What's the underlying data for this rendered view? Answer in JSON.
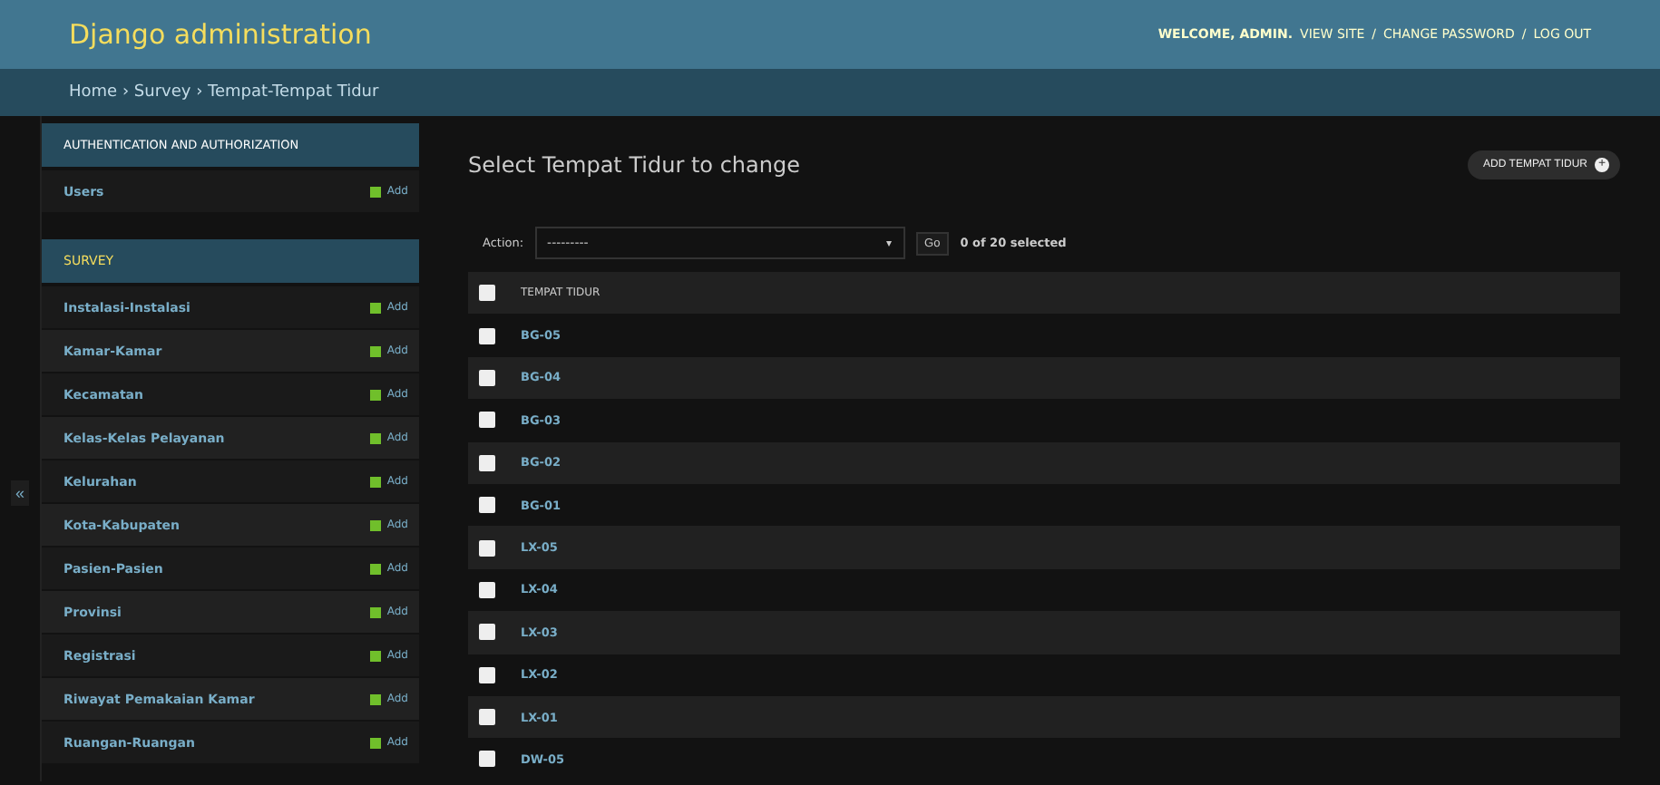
{
  "header": {
    "title": "Django administration",
    "user_tools": [
      {
        "kind": "text",
        "label": "WELCOME, ADMIN."
      },
      {
        "kind": "link",
        "label": "VIEW SITE"
      },
      {
        "kind": "sep",
        "label": "/"
      },
      {
        "kind": "link",
        "label": "CHANGE PASSWORD"
      },
      {
        "kind": "sep",
        "label": "/"
      },
      {
        "kind": "link",
        "label": "LOG OUT"
      }
    ]
  },
  "breadcrumbs": "Home › Survey › Tempat-Tempat Tidur",
  "sidebar": {
    "toggle": "«",
    "modules": [
      {
        "caption": "AUTHENTICATION AND AUTHORIZATION",
        "selected": false,
        "items": [
          {
            "label": "Users",
            "add": "Add"
          }
        ]
      },
      {
        "caption": "SURVEY",
        "selected": true,
        "items": [
          {
            "label": "Instalasi-Instalasi",
            "add": "Add"
          },
          {
            "label": "Kamar-Kamar",
            "add": "Add"
          },
          {
            "label": "Kecamatan",
            "add": "Add"
          },
          {
            "label": "Kelas-Kelas Pelayanan",
            "add": "Add"
          },
          {
            "label": "Kelurahan",
            "add": "Add"
          },
          {
            "label": "Kota-Kabupaten",
            "add": "Add"
          },
          {
            "label": "Pasien-Pasien",
            "add": "Add"
          },
          {
            "label": "Provinsi",
            "add": "Add"
          },
          {
            "label": "Registrasi",
            "add": "Add"
          },
          {
            "label": "Riwayat Pemakaian Kamar",
            "add": "Add"
          },
          {
            "label": "Ruangan-Ruangan",
            "add": "Add"
          }
        ]
      }
    ]
  },
  "content": {
    "title": "Select Tempat Tidur to change",
    "add_button": "ADD TEMPAT TIDUR",
    "add_icon": "+",
    "actions": {
      "label": "Action:",
      "select": "---------",
      "select_caret": "▾",
      "go": "Go",
      "counter": "0 of 20 selected"
    },
    "table": {
      "column": "TEMPAT TIDUR",
      "checked": false,
      "rows": [
        {
          "label": "BG-05",
          "checked": false
        },
        {
          "label": "BG-04",
          "checked": false
        },
        {
          "label": "BG-03",
          "checked": false
        },
        {
          "label": "BG-02",
          "checked": false
        },
        {
          "label": "BG-01",
          "checked": false
        },
        {
          "label": "LX-05",
          "checked": false
        },
        {
          "label": "LX-04",
          "checked": false
        },
        {
          "label": "LX-03",
          "checked": false
        },
        {
          "label": "LX-02",
          "checked": false
        },
        {
          "label": "LX-01",
          "checked": false
        },
        {
          "label": "DW-05",
          "checked": false
        }
      ]
    }
  }
}
